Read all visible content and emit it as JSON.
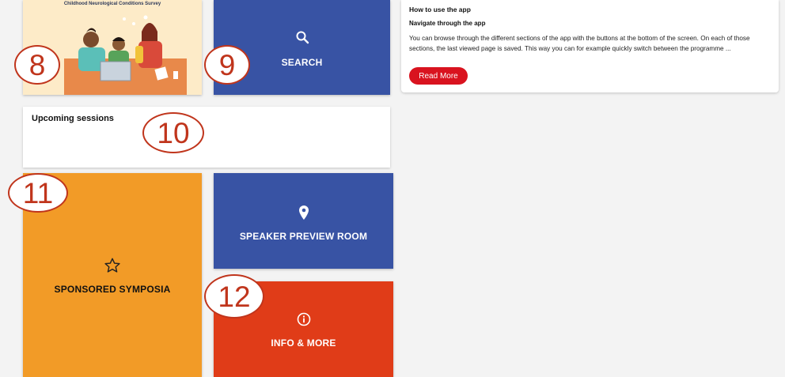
{
  "survey_banner": {
    "caption": "Childhood Neurological Conditions Survey"
  },
  "search_tile": {
    "label": "SEARCH",
    "icon": "search-icon",
    "color": "#3853a4"
  },
  "how_to": {
    "heading": "How to use the app",
    "subheading": "Navigate through the app",
    "body": "You can browse through the different sections of the app with the buttons at the bottom of the screen. On each of those sections, the last viewed page is saved. This way you can for example quickly switch between the programme ...",
    "read_more": "Read More",
    "button_color": "#d9131f"
  },
  "upcoming": {
    "title": "Upcoming sessions"
  },
  "sponsored_tile": {
    "label": "SPONSORED SYMPOSIA",
    "icon": "star-icon",
    "color": "#f29b27"
  },
  "speaker_tile": {
    "label": "SPEAKER PREVIEW ROOM",
    "icon": "location-pin-icon",
    "color": "#3853a4"
  },
  "info_tile": {
    "label": "INFO & MORE",
    "icon": "info-icon",
    "color": "#e03c18"
  },
  "badges": [
    "8",
    "9",
    "10",
    "11",
    "12"
  ]
}
